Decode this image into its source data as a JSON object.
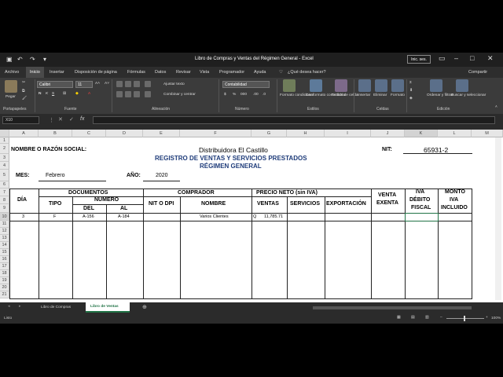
{
  "window": {
    "title": "Libro de Compras y Ventas del Régimen General  -  Excel",
    "signin": "Inic. ses."
  },
  "menu": {
    "items": [
      "Archivo",
      "Inicio",
      "Insertar",
      "Disposición de página",
      "Fórmulas",
      "Datos",
      "Revisar",
      "Vista",
      "Programador",
      "Ayuda"
    ],
    "tell_me": "¿Qué desea hacer?",
    "share": "Compartir"
  },
  "ribbon": {
    "paste": "Pegar",
    "font_name": "Calibri",
    "font_size": "11",
    "wrap_text": "Ajustar texto",
    "merge": "Combinar y centrar",
    "number_format": "Contabilidad",
    "cond_format": "Formato condicional",
    "format_table": "Dar formato como tabla",
    "cell_styles": "Estilos de celda",
    "insert": "Insertar",
    "delete": "Eliminar",
    "format": "Formato",
    "sort": "Ordenar y filtrar",
    "find": "Buscar y seleccionar",
    "groups": [
      "Portapapeles",
      "Fuente",
      "Alineación",
      "Número",
      "Estilos",
      "Celdas",
      "Edición"
    ]
  },
  "formula_bar": {
    "name_box": "X10",
    "fx": "fx",
    "content": ""
  },
  "columns": [
    "A",
    "B",
    "C",
    "D",
    "E",
    "F",
    "G",
    "H",
    "I",
    "J",
    "K",
    "L",
    "M"
  ],
  "rows": [
    "1",
    "2",
    "3",
    "4",
    "5",
    "6",
    "7",
    "8",
    "9",
    "10",
    "11",
    "12",
    "13",
    "14",
    "15",
    "16",
    "17",
    "18",
    "19",
    "20",
    "21"
  ],
  "sheet": {
    "razon_label": "NOMBRE O RAZÓN SOCIAL:",
    "company": "Distribuidora El Castillo",
    "nit_label": "NIT:",
    "nit": "65931-2",
    "title1": "REGISTRO DE VENTAS Y SERVICIOS PRESTADOS",
    "title2": "RÉGIMEN GENERAL",
    "mes_label": "MES:",
    "mes": "Febrero",
    "anio_label": "AÑO:",
    "anio": "2020",
    "h_dia": "DÍA",
    "h_documentos": "DOCUMENTOS",
    "h_tipo": "TIPO",
    "h_numero": "NUMERO",
    "h_del": "DEL",
    "h_al": "AL",
    "h_comprador": "COMPRADOR",
    "h_nit": "NIT O DPI",
    "h_nombre": "NOMBRE",
    "h_precio": "PRECIO NETO (sin IVA)",
    "h_ventas": "VENTAS",
    "h_servicios": "SERVICIOS",
    "h_exportacion": "EXPORTACIÓN",
    "h_venta": "VENTA",
    "h_exenta": "EXENTA",
    "h_iva": "IVA",
    "h_debito": "DÉBITO",
    "h_fiscal": "FISCAL",
    "h_monto": "MONTO",
    "h_iva2": "IVA",
    "h_incluido": "INCLUIDO",
    "r_dia": "3",
    "r_tipo": "F",
    "r_del": "A-156",
    "r_al": "A-184",
    "r_nombre": "Varios Clientes",
    "r_q": "Q",
    "r_ventas": "11,785.71"
  },
  "tabs": [
    "Libro de Compras",
    "Libro de Ventas"
  ],
  "status": {
    "ready": "Listo",
    "zoom": "100%"
  }
}
